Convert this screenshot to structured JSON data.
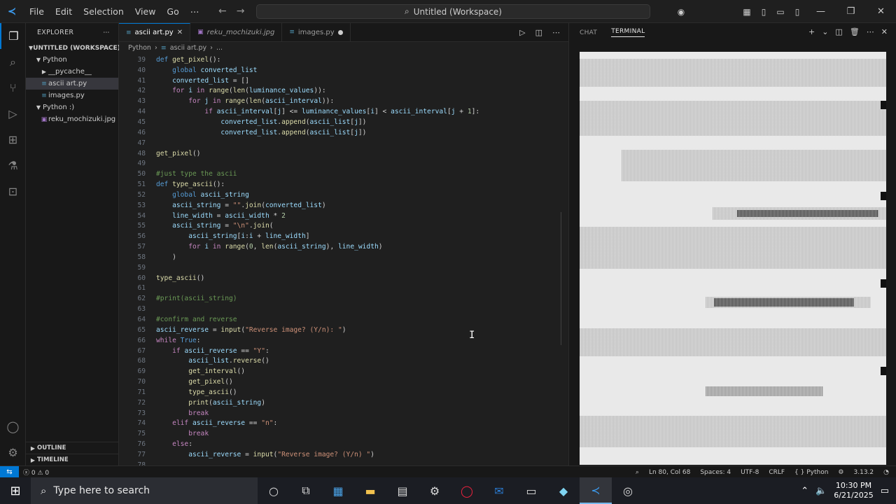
{
  "menu": [
    "File",
    "Edit",
    "Selection",
    "View",
    "Go",
    "⋯"
  ],
  "title": "Untitled (Workspace)",
  "sidebar": {
    "header": "EXPLORER",
    "workspace": "UNTITLED (WORKSPACE)",
    "items": [
      {
        "label": "Python",
        "type": "folder",
        "depth": 1,
        "open": true
      },
      {
        "label": "__pycache__",
        "type": "folder",
        "depth": 2,
        "open": false
      },
      {
        "label": "ascii art.py",
        "type": "py",
        "depth": 2,
        "selected": true
      },
      {
        "label": "images.py",
        "type": "py",
        "depth": 2
      },
      {
        "label": "Python :)",
        "type": "folder",
        "depth": 1,
        "open": true
      },
      {
        "label": "reku_mochizuki.jpg",
        "type": "img",
        "depth": 2
      }
    ],
    "outline": "OUTLINE",
    "timeline": "TIMELINE"
  },
  "tabs": [
    {
      "label": "ascii art.py",
      "type": "py",
      "active": true,
      "close": "✕"
    },
    {
      "label": "reku_mochizuki.jpg",
      "type": "img",
      "italic": true
    },
    {
      "label": "images.py",
      "type": "py",
      "dirty": true
    }
  ],
  "breadcrumb": [
    "Python",
    "ascii art.py",
    "..."
  ],
  "code_lines": [
    {
      "n": "39",
      "html": "<span class='kb'>def</span> <span class='fn'>get_pixel</span>():"
    },
    {
      "n": "40",
      "html": "    <span class='kb'>global</span> <span class='vr'>converted_list</span>"
    },
    {
      "n": "41",
      "html": "    <span class='vr'>converted_list</span> = []"
    },
    {
      "n": "42",
      "html": "    <span class='kw'>for</span> <span class='vr'>i</span> <span class='kw'>in</span> <span class='fn'>range</span>(<span class='fn'>len</span>(<span class='vr'>luminance_values</span>)):"
    },
    {
      "n": "43",
      "html": "        <span class='kw'>for</span> <span class='vr'>j</span> <span class='kw'>in</span> <span class='fn'>range</span>(<span class='fn'>len</span>(<span class='vr'>ascii_interval</span>)):"
    },
    {
      "n": "44",
      "html": "            <span class='kw'>if</span> <span class='vr'>ascii_interval</span>[<span class='vr'>j</span>] &lt;= <span class='vr'>luminance_values</span>[<span class='vr'>i</span>] &lt; <span class='vr'>ascii_interval</span>[<span class='vr'>j</span> + <span class='num'>1</span>]:"
    },
    {
      "n": "45",
      "html": "                <span class='vr'>converted_list</span>.<span class='fn'>append</span>(<span class='vr'>ascii_list</span>[<span class='vr'>j</span>])"
    },
    {
      "n": "46",
      "html": "                <span class='vr'>converted_list</span>.<span class='fn'>append</span>(<span class='vr'>ascii_list</span>[<span class='vr'>j</span>])"
    },
    {
      "n": "47",
      "html": ""
    },
    {
      "n": "48",
      "html": "<span class='fn'>get_pixel</span>()"
    },
    {
      "n": "49",
      "html": ""
    },
    {
      "n": "50",
      "html": "<span class='cm'>#just type the ascii</span>"
    },
    {
      "n": "51",
      "html": "<span class='kb'>def</span> <span class='fn'>type_ascii</span>():"
    },
    {
      "n": "52",
      "html": "    <span class='kb'>global</span> <span class='vr'>ascii_string</span>"
    },
    {
      "n": "53",
      "html": "    <span class='vr'>ascii_string</span> = <span class='str'>\"\"</span>.<span class='fn'>join</span>(<span class='vr'>converted_list</span>)"
    },
    {
      "n": "54",
      "html": "    <span class='vr'>line_width</span> = <span class='vr'>ascii_width</span> * <span class='num'>2</span>"
    },
    {
      "n": "55",
      "html": "    <span class='vr'>ascii_string</span> = <span class='str'>\"\\n\"</span>.<span class='fn'>join</span>("
    },
    {
      "n": "56",
      "html": "        <span class='vr'>ascii_string</span>[<span class='vr'>i</span>:<span class='vr'>i</span> + <span class='vr'>line_width</span>]"
    },
    {
      "n": "57",
      "html": "        <span class='kw'>for</span> <span class='vr'>i</span> <span class='kw'>in</span> <span class='fn'>range</span>(<span class='num'>0</span>, <span class='fn'>len</span>(<span class='vr'>ascii_string</span>), <span class='vr'>line_width</span>)"
    },
    {
      "n": "58",
      "html": "    )"
    },
    {
      "n": "59",
      "html": ""
    },
    {
      "n": "60",
      "html": "<span class='fn'>type_ascii</span>()"
    },
    {
      "n": "61",
      "html": ""
    },
    {
      "n": "62",
      "html": "<span class='cm'>#print(ascii_string)</span>"
    },
    {
      "n": "63",
      "html": ""
    },
    {
      "n": "64",
      "html": "<span class='cm'>#confirm and reverse</span>"
    },
    {
      "n": "65",
      "html": "<span class='vr'>ascii_reverse</span> = <span class='fn'>input</span>(<span class='str'>\"Reverse image? (Y/n): \"</span>)"
    },
    {
      "n": "66",
      "html": "<span class='kw'>while</span> <span class='kb'>True</span>:"
    },
    {
      "n": "67",
      "html": "    <span class='kw'>if</span> <span class='vr'>ascii_reverse</span> == <span class='str'>\"Y\"</span>:"
    },
    {
      "n": "68",
      "html": "        <span class='vr'>ascii_list</span>.<span class='fn'>reverse</span>()"
    },
    {
      "n": "69",
      "html": "        <span class='fn'>get_interval</span>()"
    },
    {
      "n": "70",
      "html": "        <span class='fn'>get_pixel</span>()"
    },
    {
      "n": "71",
      "html": "        <span class='fn'>type_ascii</span>()"
    },
    {
      "n": "72",
      "html": "        <span class='fn'>print</span>(<span class='vr'>ascii_string</span>)"
    },
    {
      "n": "73",
      "html": "        <span class='kw'>break</span>"
    },
    {
      "n": "74",
      "html": "    <span class='kw'>elif</span> <span class='vr'>ascii_reverse</span> == <span class='str'>\"n\"</span>:"
    },
    {
      "n": "75",
      "html": "        <span class='kw'>break</span>"
    },
    {
      "n": "76",
      "html": "    <span class='kw'>else</span>:"
    },
    {
      "n": "77",
      "html": "        <span class='vr'>ascii_reverse</span> = <span class='fn'>input</span>(<span class='str'>\"Reverse image? (Y/n) \"</span>)"
    },
    {
      "n": "78",
      "html": ""
    }
  ],
  "panel": {
    "tabs": [
      "CHAT",
      "TERMINAL"
    ],
    "active": "TERMINAL"
  },
  "status": {
    "problems": "ⓧ 0 ⚠ 0",
    "position": "Ln 80, Col 68",
    "spaces": "Spaces: 4",
    "encoding": "UTF-8",
    "eol": "CRLF",
    "language": "{ } Python",
    "version": "3.13.2"
  },
  "taskbar": {
    "search_placeholder": "Type here to search",
    "time": "10:30 PM",
    "date": "6/21/2025"
  }
}
